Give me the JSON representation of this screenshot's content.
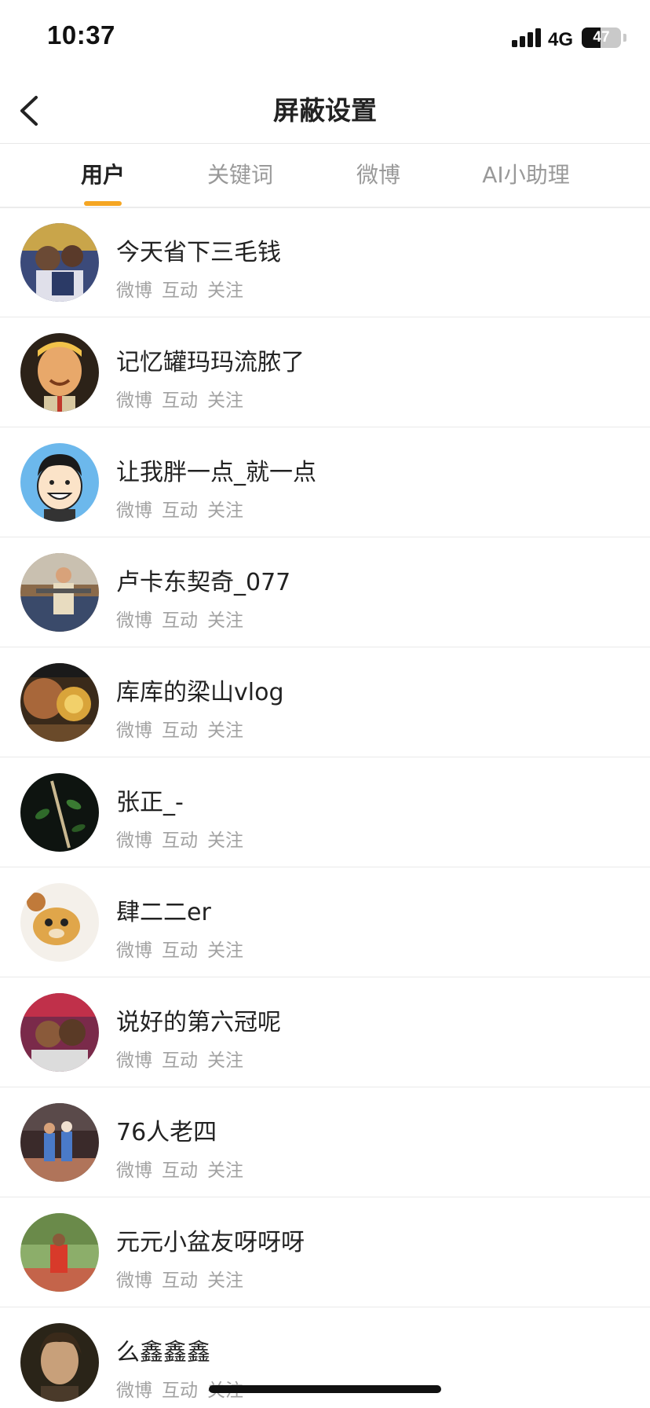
{
  "status_bar": {
    "time": "10:37",
    "network": "4G",
    "battery": "47",
    "battery_level": 0.47
  },
  "nav": {
    "title": "屏蔽设置",
    "back_icon": "chevron-left-icon"
  },
  "tabs": [
    {
      "label": "用户",
      "active": true
    },
    {
      "label": "关键词",
      "active": false
    },
    {
      "label": "微博",
      "active": false
    },
    {
      "label": "AI小助理",
      "active": false
    }
  ],
  "accent_color": "#f5a623",
  "users": [
    {
      "name": "今天省下三毛钱",
      "actions": [
        "微博",
        "互动",
        "关注"
      ]
    },
    {
      "name": "记忆罐玛玛流脓了",
      "actions": [
        "微博",
        "互动",
        "关注"
      ]
    },
    {
      "name": "让我胖一点_就一点",
      "actions": [
        "微博",
        "互动",
        "关注"
      ]
    },
    {
      "name": "卢卡东契奇_077",
      "actions": [
        "微博",
        "互动",
        "关注"
      ]
    },
    {
      "name": "库库的梁山vlog",
      "actions": [
        "微博",
        "互动",
        "关注"
      ]
    },
    {
      "name": "张正_-",
      "actions": [
        "微博",
        "互动",
        "关注"
      ]
    },
    {
      "name": "肆二二er",
      "actions": [
        "微博",
        "互动",
        "关注"
      ]
    },
    {
      "name": "说好的第六冠呢",
      "actions": [
        "微博",
        "互动",
        "关注"
      ]
    },
    {
      "name": "76人老四",
      "actions": [
        "微博",
        "互动",
        "关注"
      ]
    },
    {
      "name": "元元小盆友呀呀呀",
      "actions": [
        "微博",
        "互动",
        "关注"
      ]
    },
    {
      "name": "么鑫鑫鑫",
      "actions": [
        "微博",
        "互动",
        "关注"
      ]
    }
  ]
}
